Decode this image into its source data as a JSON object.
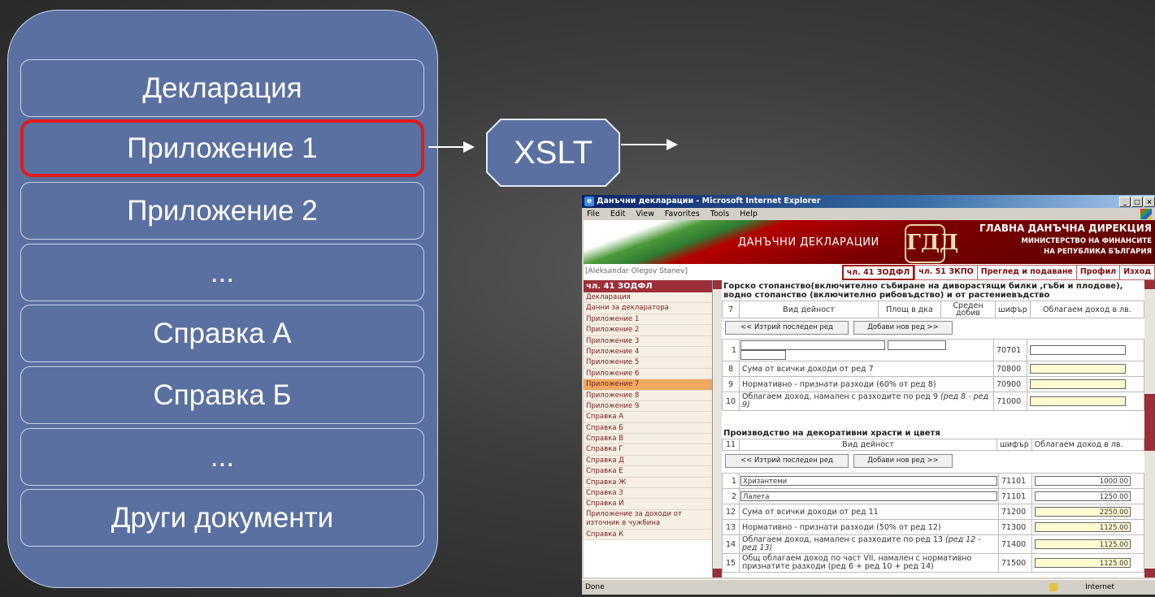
{
  "stack": {
    "items": [
      {
        "label": "Декларация"
      },
      {
        "label": "Приложение 1",
        "selected": true
      },
      {
        "label": "Приложение 2"
      },
      {
        "label": "..."
      },
      {
        "label": "Справка А"
      },
      {
        "label": "Справка Б"
      },
      {
        "label": "..."
      },
      {
        "label": "Други документи"
      }
    ],
    "highlight_color": "#e11a1a"
  },
  "xslt": {
    "label": "XSLT"
  },
  "browser": {
    "title": "Данъчни декларации - Microsoft Internet Explorer",
    "window_buttons": [
      "_",
      "□",
      "×"
    ],
    "menu": [
      "File",
      "Edit",
      "View",
      "Favorites",
      "Tools",
      "Help"
    ],
    "banner": {
      "title": "ДАНЪЧНИ ДЕКЛАРАЦИИ",
      "seal": "ГДД",
      "agency": "ГЛАВНА ДАНЪЧНА ДИРЕКЦИЯ",
      "ministry_1": "МИНИСТЕРСТВО НА ФИНАНСИТЕ",
      "ministry_2": "НА РЕПУБЛИКА БЪЛГАРИЯ"
    },
    "user": "[Aleksandar Olegov Stanev]",
    "topnav": [
      "чл. 41 ЗОДФЛ",
      "чл. 51 ЗКПО",
      "Преглед и подаване",
      "Профил",
      "Изход"
    ],
    "left_nav": {
      "header": "чл. 41 ЗОДФЛ",
      "items": [
        "Декларация",
        "Данни за декларатора",
        "Приложение 1",
        "Приложение 2",
        "Приложение 3",
        "Приложение 4",
        "Приложение 5",
        "Приложение 6",
        "Приложение 7",
        "Приложение 8",
        "Приложение 9",
        "Справка А",
        "Справка Б",
        "Справка В",
        "Справка Г",
        "Справка Д",
        "Справка Е",
        "Справка Ж",
        "Справка З",
        "Справка И",
        "Приложение за доходи от източник в чужбина",
        "Справка К"
      ],
      "current": "Приложение 7"
    },
    "content": {
      "section1_title": "Горско стопанство(включително събиране на диворастящи билки ,гъби и плодове), водно стопанство (включително рибовъдство) и от растениевъдство",
      "table1_header": {
        "num": "7",
        "activity": "Вид дейност",
        "area": "Площ в дка",
        "avg_yield": "Среден добив",
        "code": "шифър",
        "income": "Облагаем доход в лв."
      },
      "btn_delete": "<< Изтрий последен ред",
      "btn_add": "Добави нов ред >>",
      "t1_row1": {
        "num": "1",
        "code": "70701"
      },
      "t1_rows": [
        {
          "num": "8",
          "text": "Сума от всички доходи от ред 7",
          "code": "70800"
        },
        {
          "num": "9",
          "text": "Нормативно - признати разходи (60% от ред 8)",
          "code": "70900"
        },
        {
          "num": "10",
          "text": "Облагаем доход, намален с разходите по ред 9",
          "note": "(ред 8 - ред 9)",
          "code": "71000"
        }
      ],
      "section2_title": "Производство на декоративни храсти и цветя",
      "table2_header": {
        "num": "11",
        "activity": "Вид дейност",
        "code": "шифър",
        "income": "Облагаем доход в лв."
      },
      "t2_items": [
        {
          "num": "1",
          "name": "Хризантеми",
          "code": "71101",
          "value": "1000.00"
        },
        {
          "num": "2",
          "name": "Лалета",
          "code": "71101",
          "value": "1250.00"
        }
      ],
      "t2_rows": [
        {
          "num": "12",
          "text": "Сума от всички доходи от ред 11",
          "code": "71200",
          "value": "2250.00"
        },
        {
          "num": "13",
          "text": "Нормативно - признати разходи (50% от ред 12)",
          "code": "71300",
          "value": "1125.00"
        },
        {
          "num": "14",
          "text": "Облагаем доход, намален с разходите по ред 13",
          "note": "(ред 12 - ред 13)",
          "code": "71400",
          "value": "1125.00"
        },
        {
          "num": "15",
          "text": "Общ облагаем доход по част VII, намален с нормативно признатите разходи (ред 6 + ред 10 + ред 14)",
          "code": "71500",
          "value": "1125.00"
        }
      ]
    },
    "status": {
      "done": "Done",
      "zone": "Internet"
    }
  }
}
